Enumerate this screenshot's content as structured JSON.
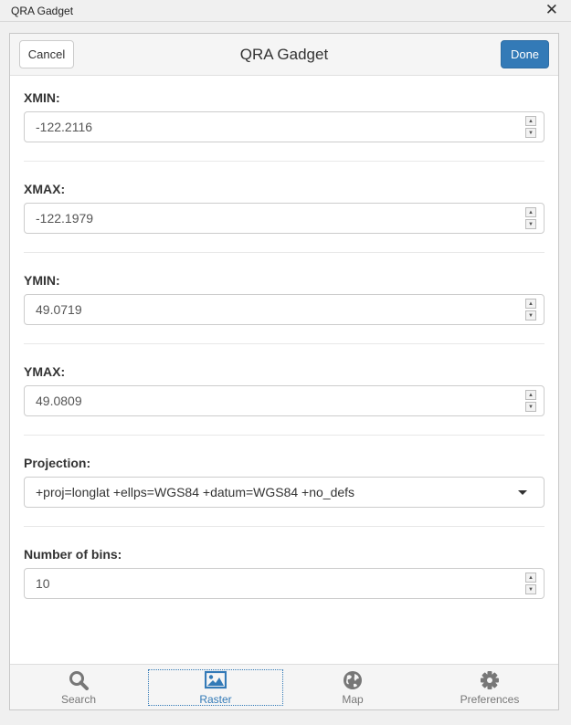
{
  "window": {
    "title": "QRA Gadget",
    "close_glyph": "✕"
  },
  "header": {
    "cancel_label": "Cancel",
    "title": "QRA Gadget",
    "done_label": "Done"
  },
  "fields": {
    "xmin": {
      "label": "XMIN:",
      "value": "-122.2116"
    },
    "xmax": {
      "label": "XMAX:",
      "value": "-122.1979"
    },
    "ymin": {
      "label": "YMIN:",
      "value": "49.0719"
    },
    "ymax": {
      "label": "YMAX:",
      "value": "49.0809"
    },
    "projection": {
      "label": "Projection:",
      "value": "+proj=longlat +ellps=WGS84 +datum=WGS84 +no_defs"
    },
    "bins": {
      "label": "Number of bins:",
      "value": "10"
    }
  },
  "tabs": [
    {
      "label": "Search",
      "icon": "search-icon"
    },
    {
      "label": "Raster",
      "icon": "image-icon",
      "active": true
    },
    {
      "label": "Map",
      "icon": "globe-icon"
    },
    {
      "label": "Preferences",
      "icon": "gear-icon"
    }
  ],
  "colors": {
    "primary": "#337ab7",
    "tab_inactive": "#777777"
  }
}
